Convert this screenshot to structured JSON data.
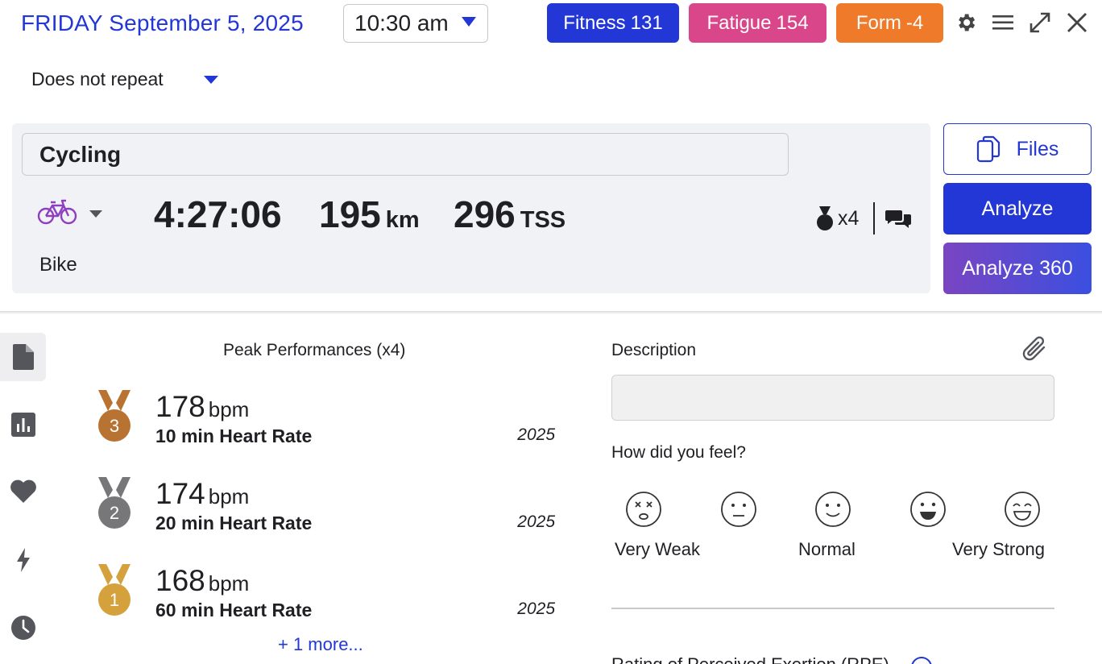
{
  "header": {
    "date": "FRIDAY September 5, 2025",
    "time": "10:30 am",
    "repeat": "Does not repeat",
    "pills": {
      "fitness_label": "Fitness",
      "fitness_value": "131",
      "fatigue_label": "Fatigue",
      "fatigue_value": "154",
      "form_label": "Form",
      "form_value": "-4"
    },
    "icons": [
      "gear-icon",
      "menu-icon",
      "expand-icon",
      "close-icon"
    ]
  },
  "activity": {
    "name": "Cycling",
    "sport_icon": "bike-icon",
    "sport": "Bike",
    "duration": "4:27:06",
    "distance": "195",
    "distance_unit": "km",
    "tss": "296",
    "tss_unit": "TSS",
    "medal_count": "x4"
  },
  "buttons": {
    "files": "Files",
    "analyze": "Analyze",
    "analyze360": "Analyze 360"
  },
  "rail": [
    "document-icon",
    "chart-icon",
    "heart-icon",
    "lightning-icon",
    "clock-icon"
  ],
  "peaks": {
    "title": "Peak Performances (x4)",
    "items": [
      {
        "rank": "3",
        "value": "178",
        "unit": "bpm",
        "label": "10 min Heart Rate",
        "year": "2025"
      },
      {
        "rank": "2",
        "value": "174",
        "unit": "bpm",
        "label": "20 min Heart Rate",
        "year": "2025"
      },
      {
        "rank": "1",
        "value": "168",
        "unit": "bpm",
        "label": "60 min Heart Rate",
        "year": "2025"
      }
    ],
    "more": "+ 1 more..."
  },
  "description": {
    "label": "Description",
    "value": "",
    "feel_label": "How did you feel?",
    "feel_options": [
      "Very Weak",
      "Normal",
      "Very Strong"
    ],
    "rpe_label": "Rating of Perceived Exertion (RPE)"
  },
  "colors": {
    "accent": "#2336d6",
    "fatigue": "#d9478a",
    "form": "#ef7a2a",
    "bronze": "#b87333",
    "silver": "#77777a",
    "gold": "#d4a13c",
    "sport": "#8e3fbf"
  }
}
